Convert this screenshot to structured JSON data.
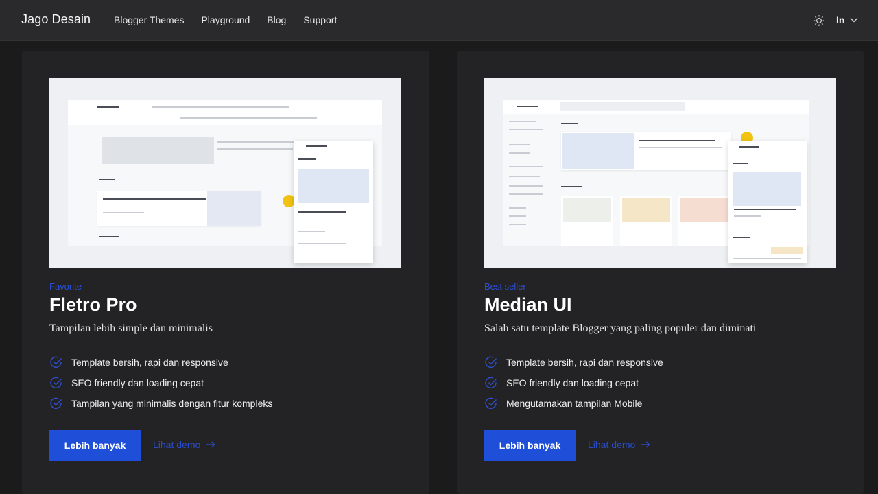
{
  "header": {
    "brand": "Jago Desain",
    "nav": [
      "Blogger Themes",
      "Playground",
      "Blog",
      "Support"
    ],
    "lang": "In",
    "icons": {
      "theme": "sun-icon",
      "lang_caret": "chevron-down-icon"
    }
  },
  "cards": [
    {
      "eyebrow": "Favorite",
      "title": "Fletro Pro",
      "subtitle": "Tampilan lebih simple dan minimalis",
      "features": [
        "Template bersih, rapi dan responsive",
        "SEO friendly dan loading cepat",
        "Tampilan yang minimalis dengan fitur kompleks"
      ],
      "primary_label": "Lebih banyak",
      "demo_label": "Lihat demo"
    },
    {
      "eyebrow": "Best seller",
      "title": "Median UI",
      "subtitle": "Salah satu template Blogger yang paling populer dan diminati",
      "features": [
        "Template bersih, rapi dan responsive",
        "SEO friendly dan loading cepat",
        "Mengutamakan tampilan Mobile"
      ],
      "primary_label": "Lebih banyak",
      "demo_label": "Lihat demo"
    }
  ],
  "colors": {
    "background": "#1b1b1c",
    "topbar": "#2a2a2c",
    "card": "#232325",
    "accent": "#1f4fd8",
    "eyebrow": "#2c4fd6"
  }
}
